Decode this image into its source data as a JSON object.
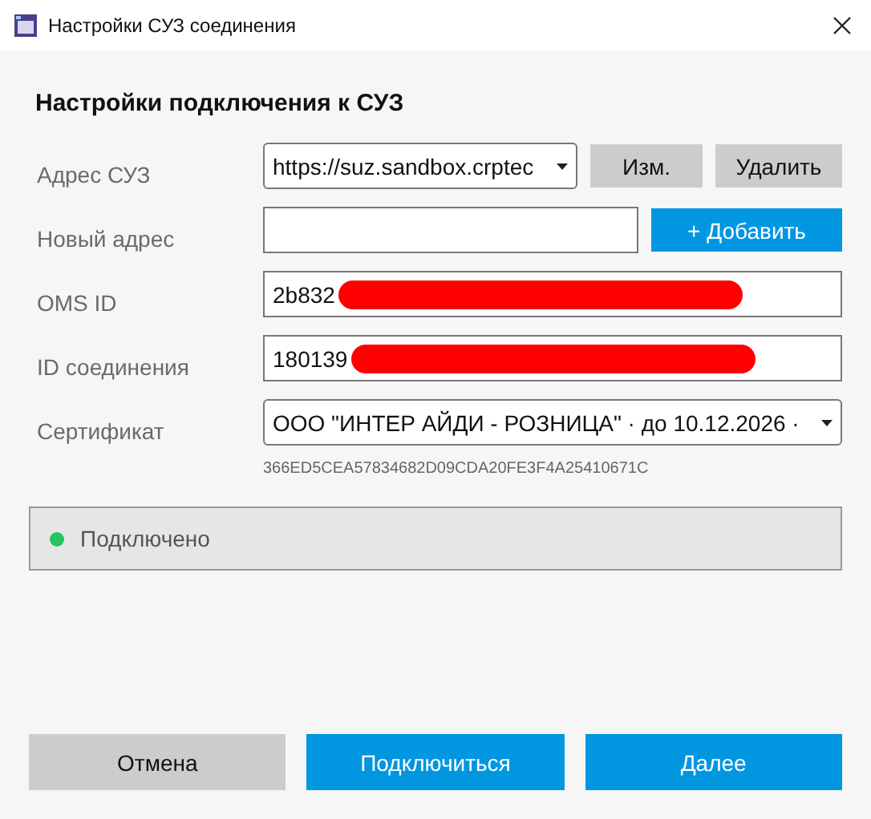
{
  "window": {
    "title": "Настройки СУЗ соединения"
  },
  "heading": "Настройки подключения к СУЗ",
  "fields": [
    {
      "kind": "select",
      "label": "Адрес СУЗ",
      "value": "https://suz.sandbox.crptec",
      "buttons": [
        {
          "label": "Изм.",
          "primary": false
        },
        {
          "label": "Удалить",
          "primary": false
        }
      ]
    },
    {
      "kind": "input",
      "label": "Новый адрес",
      "buttons": [
        {
          "label": "+  Добавить",
          "primary": true
        }
      ]
    },
    {
      "kind": "input",
      "label": "OMS ID",
      "value": "2b832",
      "redacted": true
    },
    {
      "kind": "input",
      "label": "ID соединения",
      "value": "180139",
      "redacted": true
    },
    {
      "kind": "select",
      "label": "Сертификат",
      "value": "ООО \"ИНТЕР АЙДИ - РОЗНИЦА\" · до 10.12.2026 ·",
      "note": "366ED5CEA57834682D09CDA20FE3F4A25410671C"
    }
  ],
  "status": {
    "connected": true,
    "text": "Подключено"
  },
  "footer_buttons": [
    {
      "label": "Отмена",
      "primary": false
    },
    {
      "label": "Подключиться",
      "primary": true
    },
    {
      "label": "Далее",
      "primary": true
    }
  ]
}
